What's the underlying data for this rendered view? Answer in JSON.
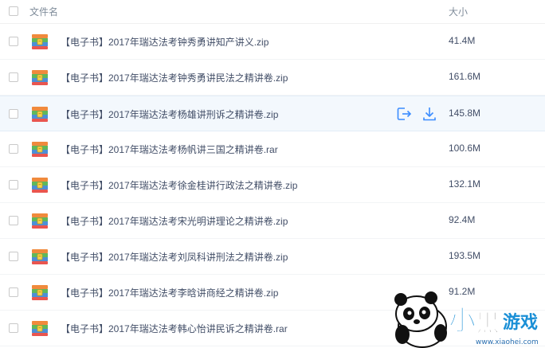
{
  "header": {
    "name_label": "文件名",
    "size_label": "大小"
  },
  "files": [
    {
      "name": "【电子书】2017年瑞达法考钟秀勇讲知产讲义.zip",
      "size": "41.4M"
    },
    {
      "name": "【电子书】2017年瑞达法考钟秀勇讲民法之精讲卷.zip",
      "size": "161.6M"
    },
    {
      "name": "【电子书】2017年瑞达法考杨雄讲刑诉之精讲卷.zip",
      "size": "145.8M"
    },
    {
      "name": "【电子书】2017年瑞达法考杨帆讲三国之精讲卷.rar",
      "size": "100.6M"
    },
    {
      "name": "【电子书】2017年瑞达法考徐金桂讲行政法之精讲卷.zip",
      "size": "132.1M"
    },
    {
      "name": "【电子书】2017年瑞达法考宋光明讲理论之精讲卷.zip",
      "size": "92.4M"
    },
    {
      "name": "【电子书】2017年瑞达法考刘凤科讲刑法之精讲卷.zip",
      "size": "193.5M"
    },
    {
      "name": "【电子书】2017年瑞达法考李晗讲商经之精讲卷.zip",
      "size": "91.2M"
    },
    {
      "name": "【电子书】2017年瑞达法考韩心怡讲民诉之精讲卷.rar",
      "size": ""
    }
  ],
  "hover_row_index": 2,
  "icons": {
    "archive": "archive-file-icon",
    "share": "share-export-icon",
    "download": "download-icon"
  },
  "watermark": {
    "brand": "小黑游戏",
    "url": "www.xiaohei.com"
  },
  "colors": {
    "text": "#424e67",
    "header_text": "#7f8c9a",
    "accent": "#3b8cff",
    "hover_bg": "#f3f8fd"
  }
}
